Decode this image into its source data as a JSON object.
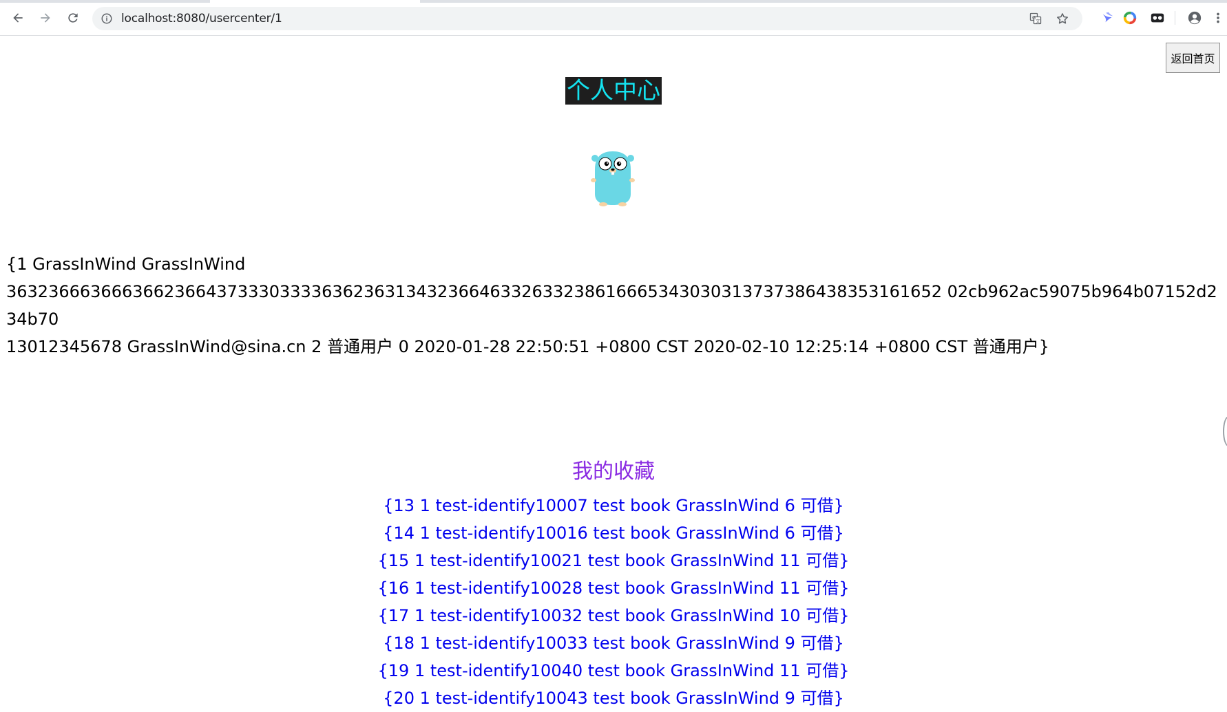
{
  "browser": {
    "url_host": "localhost",
    "url_path": ":8080/usercenter/1",
    "icons": {
      "back": "arrow-left-icon",
      "forward": "arrow-right-icon",
      "reload": "reload-icon",
      "site_info": "info-icon",
      "translate": "translate-icon",
      "bookmark": "star-icon",
      "extension_1": "swift-bird-icon",
      "extension_2": "color-ring-icon",
      "extension_3": "toggle-dot-icon",
      "profile": "account-circle-icon",
      "menu": "vertical-dots-icon"
    }
  },
  "page": {
    "back_home_label": "返回首页",
    "title": "个人中心",
    "title_colors": {
      "background": "#1e1e1e",
      "text": "#14e3f0"
    },
    "avatar_icon": "gopher-avatar-icon",
    "user_info": {
      "line1": "{1 GrassInWind GrassInWind",
      "line2": "36323666366636623664373330333363623631343236646332633238616665343030313737386438353161652 02cb962ac59075b964b07152d234b70",
      "line3": "13012345678 GrassInWind@sina.cn 2 普通用户 0 2020-01-28 22:50:51 +0800 CST 2020-02-10 12:25:14 +0800 CST 普通用户}"
    },
    "favorites": {
      "title": "我的收藏",
      "title_color": "#8a2be2",
      "link_color": "#0000ee",
      "items": [
        "{13 1 test-identify10007 test book GrassInWind 6 可借}",
        "{14 1 test-identify10016 test book GrassInWind 6 可借}",
        "{15 1 test-identify10021 test book GrassInWind 11 可借}",
        "{16 1 test-identify10028 test book GrassInWind 11 可借}",
        "{17 1 test-identify10032 test book GrassInWind 10 可借}",
        "{18 1 test-identify10033 test book GrassInWind 9 可借}",
        "{19 1 test-identify10040 test book GrassInWind 11 可借}",
        "{20 1 test-identify10043 test book GrassInWind 9 可借}"
      ]
    }
  }
}
